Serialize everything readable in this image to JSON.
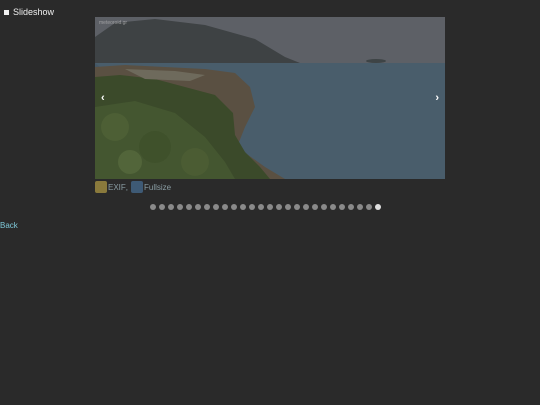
{
  "header": {
    "slideshow_label": "Slideshow"
  },
  "viewer": {
    "watermark": "meteoroid.gr",
    "prev_glyph": "‹",
    "next_glyph": "›"
  },
  "toolbar": {
    "exif_label": "EXIF",
    "separator": ",",
    "fullsize_label": "Fullsize"
  },
  "pagination": {
    "count": 26,
    "active_index": 25
  },
  "footer": {
    "back_label": "Back"
  },
  "colors": {
    "background": "#2a2a2a",
    "link": "#7ec8d8",
    "dot": "#8a8a8a",
    "dot_active": "#e0e0e0"
  }
}
